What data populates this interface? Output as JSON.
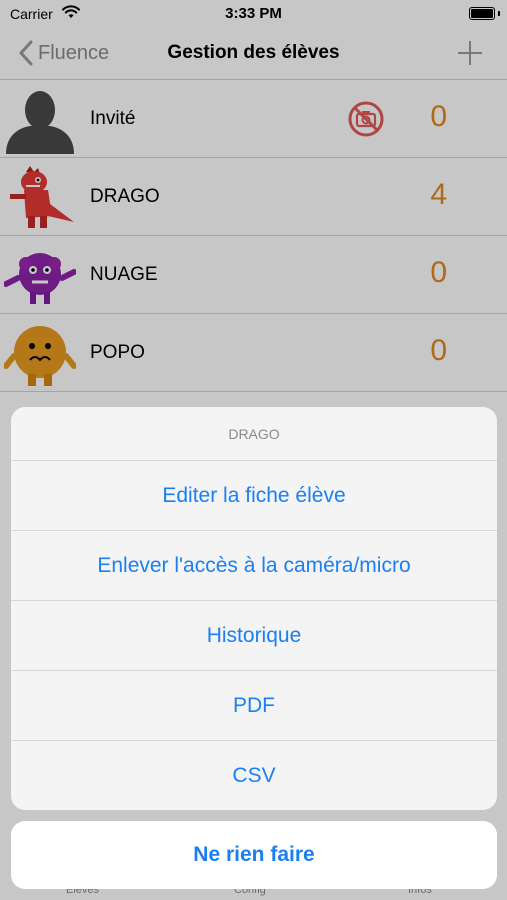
{
  "status_bar": {
    "carrier": "Carrier",
    "time": "3:33 PM"
  },
  "nav": {
    "back_label": "Fluence",
    "title": "Gestion des élèves",
    "add_icon": "plus-icon"
  },
  "students": [
    {
      "name": "Invité",
      "score": "0",
      "avatar": "silhouette-avatar",
      "camera_off": true
    },
    {
      "name": "DRAGO",
      "score": "4",
      "avatar": "red-dragon-avatar",
      "camera_off": false
    },
    {
      "name": "NUAGE",
      "score": "0",
      "avatar": "purple-monster-avatar",
      "camera_off": false
    },
    {
      "name": "POPO",
      "score": "0",
      "avatar": "orange-monster-avatar",
      "camera_off": false
    }
  ],
  "action_sheet": {
    "title": "DRAGO",
    "actions": [
      "Editer la fiche élève",
      "Enlever l'accès à la caméra/micro",
      "Historique",
      "PDF",
      "CSV"
    ],
    "cancel": "Ne rien faire"
  },
  "tab_bar": {
    "tabs": [
      "Elèves",
      "Config",
      "Infos"
    ]
  },
  "colors": {
    "accent_blue": "#1b7ff0",
    "score_orange": "#e0871e",
    "camera_off_red": "#e05a5a"
  }
}
